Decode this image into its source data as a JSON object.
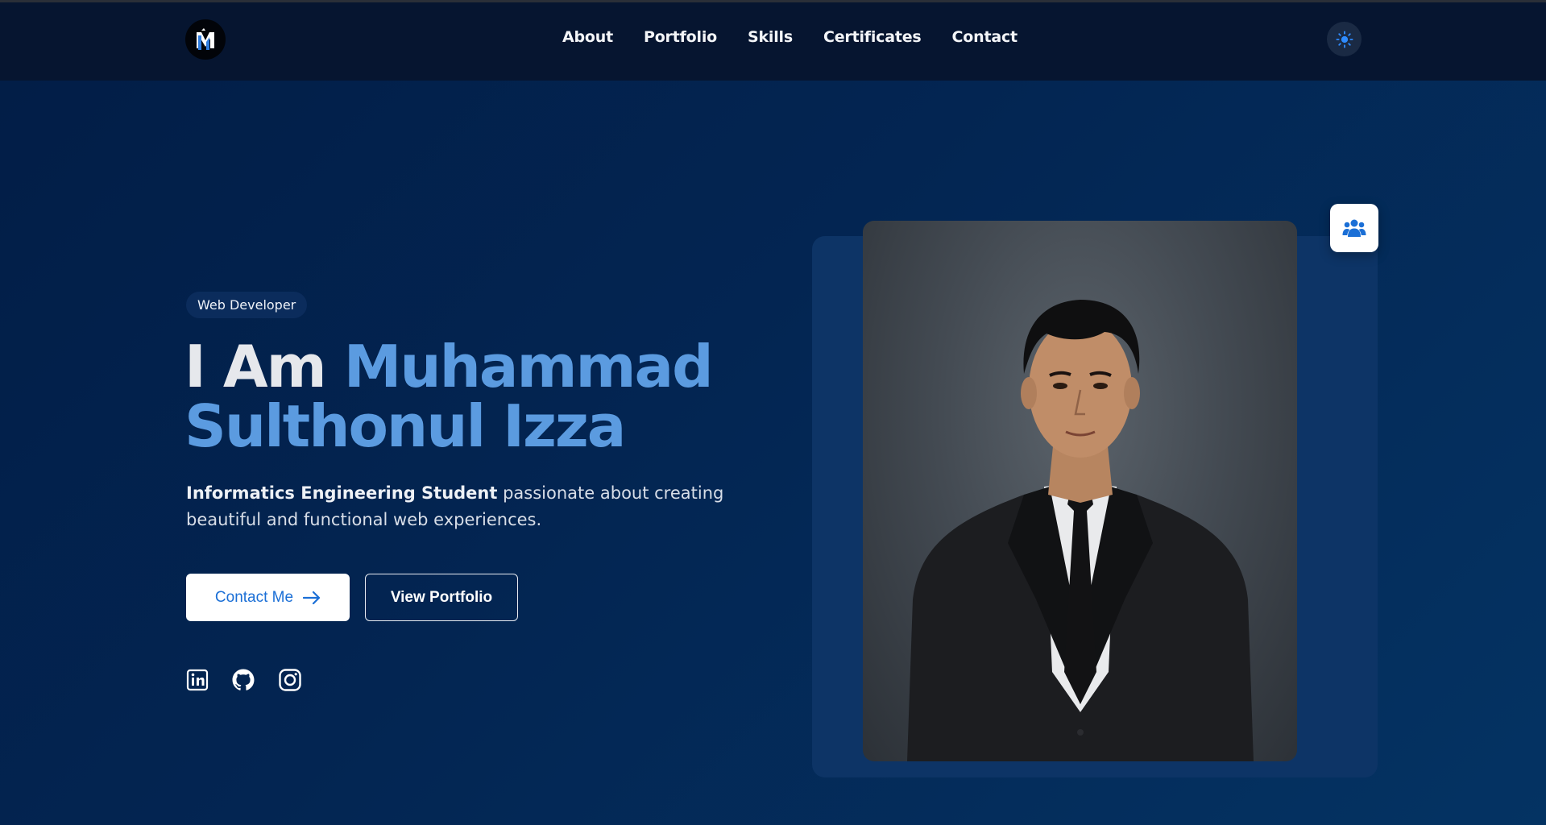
{
  "nav": {
    "logo_alt": "MSI logo",
    "links": [
      {
        "label": "About"
      },
      {
        "label": "Portfolio"
      },
      {
        "label": "Skills"
      },
      {
        "label": "Certificates"
      },
      {
        "label": "Contact"
      }
    ],
    "theme_icon": "sun-icon"
  },
  "hero": {
    "badge": "Web Developer",
    "headline_prefix": "I Am",
    "headline_name_line1": "Muhammad",
    "headline_name_line2": "Sulthonul Izza",
    "desc_bold": "Informatics Engineering Student",
    "desc_rest": " passionate about creating beautiful and functional web experiences.",
    "contact_button": "Contact Me",
    "portfolio_button": "View Portfolio",
    "socials": [
      {
        "name": "linkedin-icon"
      },
      {
        "name": "github-icon"
      },
      {
        "name": "instagram-icon"
      }
    ]
  },
  "photo": {
    "description_icon": "users-icon"
  },
  "colors": {
    "accent_blue": "#5b9be0",
    "button_text_blue": "#1b6fd6",
    "nav_bg": "#061530"
  }
}
